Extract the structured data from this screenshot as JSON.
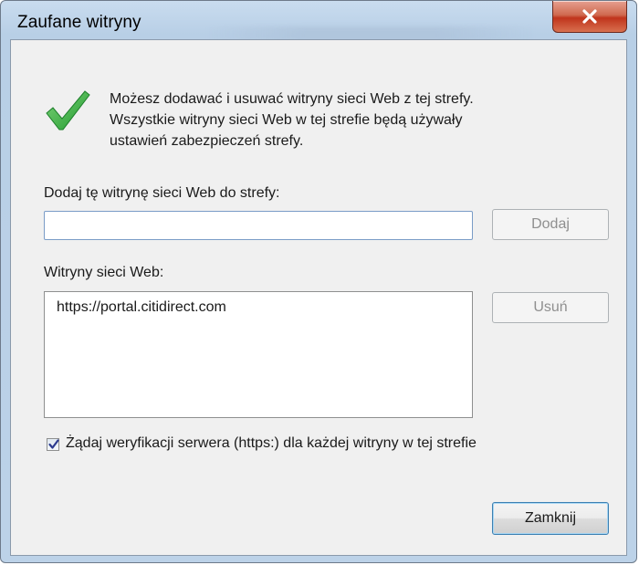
{
  "window": {
    "title": "Zaufane witryny",
    "colors": {
      "accent": "#3c7fb1",
      "close": "#c0341c"
    }
  },
  "info": {
    "icon": "checkmark-icon",
    "lines": [
      "Możesz dodawać i usuwać witryny sieci Web z tej strefy.",
      "Wszystkie witryny sieci Web w tej strefie będą używały",
      "ustawień zabezpieczeń strefy."
    ]
  },
  "add": {
    "label": "Dodaj tę witrynę sieci Web do strefy:",
    "value": "",
    "button": "Dodaj"
  },
  "sites": {
    "label": "Witryny sieci Web:",
    "items": [
      "https://portal.citidirect.com"
    ],
    "remove_button": "Usuń"
  },
  "verify": {
    "checked": true,
    "label": "Żądaj weryfikacji serwera (https:) dla każdej witryny w tej strefie"
  },
  "footer": {
    "close_button": "Zamknij"
  }
}
